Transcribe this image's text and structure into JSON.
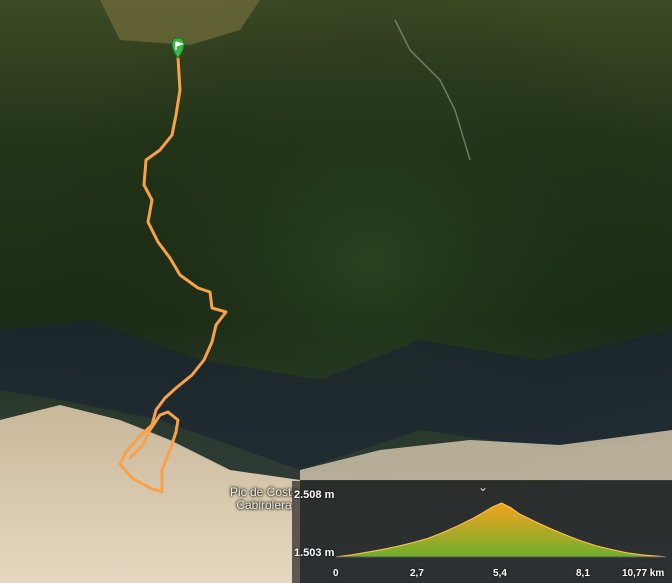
{
  "map": {
    "type": "satellite",
    "peak_label": "Pic de Costa\nCabirolera",
    "route_color": "#f7a24a",
    "start_marker_color": "#3bb54a"
  },
  "elevation_profile": {
    "max_label": "2.508 m",
    "min_label": "1.503 m",
    "distance_ticks": [
      "0",
      "2,7",
      "5,4",
      "8,1",
      "10,77 km"
    ],
    "fill_top_color": "#f4a31f",
    "fill_bottom_color": "#6fae2c",
    "collapse_icon": "chevron-down-icon",
    "chart_data": {
      "type": "area",
      "xlabel": "",
      "ylabel": "",
      "x": [
        0,
        0.5,
        1.0,
        1.5,
        2.0,
        2.5,
        3.0,
        3.5,
        4.0,
        4.5,
        4.8,
        5.1,
        5.4,
        5.7,
        6.0,
        6.5,
        7.0,
        7.5,
        8.0,
        8.5,
        9.0,
        9.5,
        10.0,
        10.77
      ],
      "y": [
        1503,
        1540,
        1590,
        1640,
        1700,
        1770,
        1850,
        1960,
        2090,
        2230,
        2330,
        2430,
        2508,
        2420,
        2300,
        2160,
        2030,
        1910,
        1800,
        1710,
        1640,
        1580,
        1540,
        1503
      ],
      "xlim": [
        0,
        10.77
      ],
      "ylim": [
        1503,
        2508
      ]
    }
  }
}
